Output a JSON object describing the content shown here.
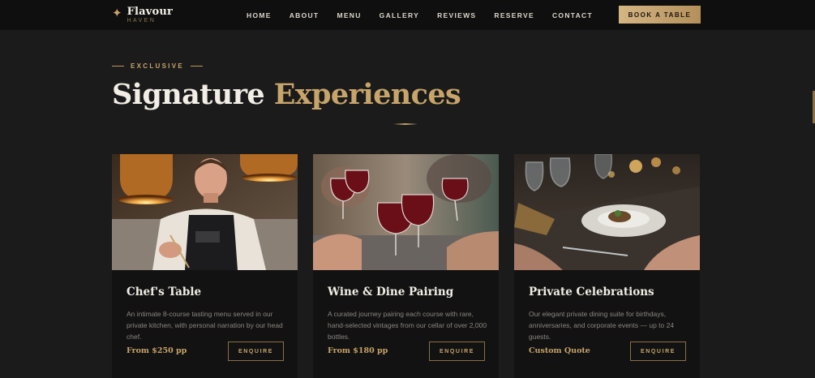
{
  "brand": {
    "name": "Flavour",
    "sub": "HAVEN",
    "star": "✦"
  },
  "nav": {
    "items": [
      {
        "label": "HOME"
      },
      {
        "label": "ABOUT"
      },
      {
        "label": "MENU"
      },
      {
        "label": "GALLERY"
      },
      {
        "label": "REVIEWS"
      },
      {
        "label": "RESERVE"
      },
      {
        "label": "CONTACT"
      }
    ],
    "cta": "BOOK A TABLE"
  },
  "section": {
    "eyebrow": "EXCLUSIVE",
    "title_main": "Signature",
    "title_accent": "Experiences"
  },
  "cards": [
    {
      "title": "Chef's Table",
      "description": "An intimate 8-course tasting menu served in our private kitchen, with personal narration by our head chef.",
      "price": "From $250 pp",
      "button": "ENQUIRE",
      "image": "chef-cooking-photo"
    },
    {
      "title": "Wine & Dine Pairing",
      "description": "A curated journey pairing each course with rare, hand-selected vintages from our cellar of over 2,000 bottles.",
      "price": "From $180 pp",
      "button": "ENQUIRE",
      "image": "wine-toast-photo"
    },
    {
      "title": "Private Celebrations",
      "description": "Our elegant private dining suite for birthdays, anniversaries, and corporate events — up to 24 guests.",
      "price": "Custom Quote",
      "button": "ENQUIRE",
      "image": "dinner-table-photo"
    }
  ],
  "colors": {
    "accent": "#c6a46a",
    "background": "#1b1b1b",
    "card": "#121212",
    "nav": "#0f0f0f"
  }
}
